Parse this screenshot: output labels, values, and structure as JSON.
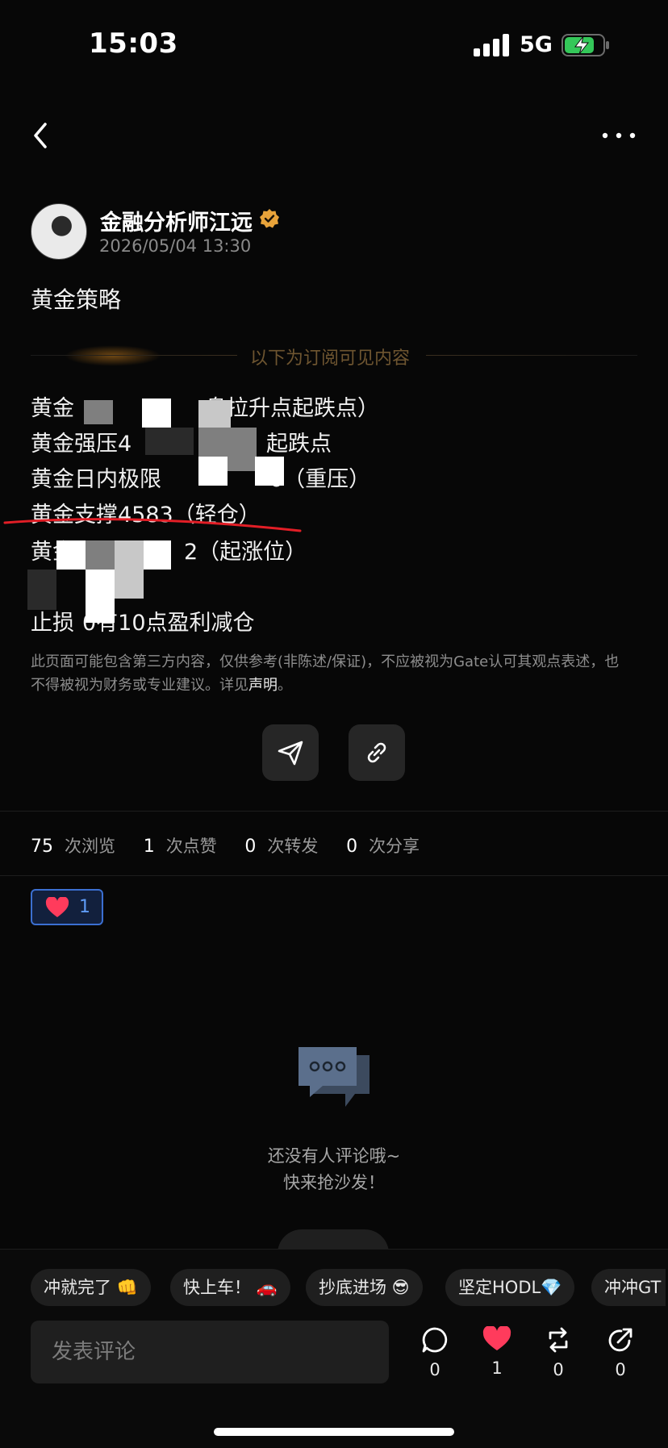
{
  "status_bar": {
    "time": "15:03",
    "network": "5G"
  },
  "post": {
    "author": "金融分析师江远",
    "date": "2026/05/04 13:30",
    "title": "黄金策略",
    "subscription_label": "以下为订阅可见内容",
    "lines": [
      {
        "visible_text_a": "黄金",
        "visible_text_b": "盘拉升点起跌点）"
      },
      {
        "visible_text_a": "黄金强压4",
        "visible_text_b": "起跌点"
      },
      {
        "visible_text_a": "黄金日内极限",
        "visible_text_b": "0（重压）"
      },
      {
        "visible_text_a": "黄金支撑4583（轻仓）"
      },
      {
        "visible_text_a": "黄金强",
        "visible_text_b": "2（起涨位）"
      },
      {
        "visible_text_a": "止损",
        "visible_text_b": "0有10点盈利减仓"
      }
    ],
    "disclaimer": "此页面可能包含第三方内容，仅供参考(非陈述/保证)，不应被视为Gate认可其观点表述，也不得被视为财务或专业建议。详见",
    "disclaimer_link": "声明",
    "disclaimer_end": "。"
  },
  "stats": {
    "views": "75",
    "views_label": "次浏览",
    "likes": "1",
    "likes_label": "次点赞",
    "reposts": "0",
    "reposts_label": "次转发",
    "shares": "0",
    "shares_label": "次分享"
  },
  "reaction": {
    "count": "1"
  },
  "empty_state": {
    "line1": "还没有人评论哦~",
    "line2": "快来抢沙发！"
  },
  "quick_replies": [
    "冲就完了 👊",
    "快上车！ 🚗",
    "抄底进场 😎",
    "坚定HODL💎",
    "冲冲GT"
  ],
  "comment_input": {
    "placeholder": "发表评论"
  },
  "actions": {
    "comments": "0",
    "likes": "1",
    "reposts": "0",
    "shares": "0"
  },
  "colors": {
    "accent_red": "#ff3b5c",
    "link_blue": "#3b6fd1",
    "verified": "#e8a33a",
    "battery_green": "#34c759"
  }
}
